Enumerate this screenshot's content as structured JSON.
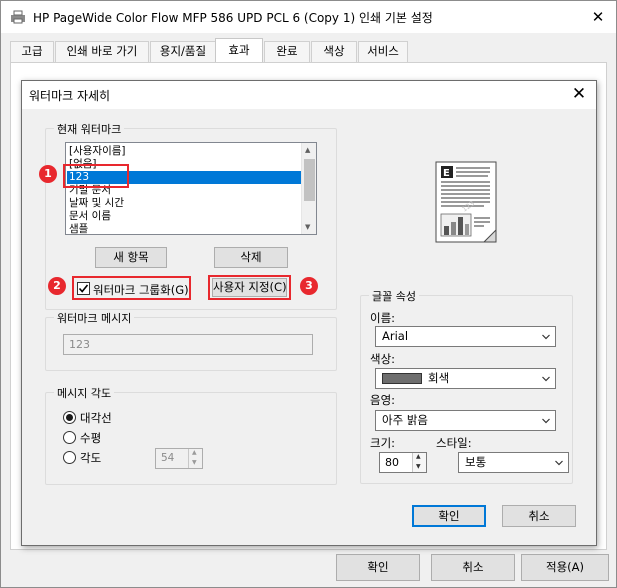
{
  "window": {
    "title": "HP PageWide Color Flow MFP 586 UPD PCL 6 (Copy 1) 인쇄 기본 설정",
    "close": "✕"
  },
  "tabs": [
    {
      "label": "고급"
    },
    {
      "label": "인쇄 바로 가기"
    },
    {
      "label": "용지/품질"
    },
    {
      "label": "효과",
      "active": true
    },
    {
      "label": "완료"
    },
    {
      "label": "색상"
    },
    {
      "label": "서비스"
    }
  ],
  "bottom_buttons": {
    "ok": "확인",
    "cancel": "취소",
    "apply": "적용(A)"
  },
  "dialog": {
    "title": "워터마크 자세히",
    "close": "✕",
    "current_watermark": {
      "label": "현재 워터마크",
      "items": [
        "[사용자이름]",
        "[없음]",
        "123",
        "기밀 문서",
        "날짜 및 시간",
        "문서 이름",
        "샘플"
      ],
      "selected_index": 2,
      "new_item": "새 항목",
      "delete": "삭제"
    },
    "callouts": [
      "1",
      "2",
      "3"
    ],
    "group_checkbox": {
      "label": "워터마크 그룹화(G)",
      "checked": true
    },
    "custom_button": "사용자 지정(C)",
    "message": {
      "label": "워터마크 메시지",
      "value": "123"
    },
    "angle": {
      "label": "메시지 각도",
      "options": [
        "대각선",
        "수평",
        "각도"
      ],
      "selected_index": 0,
      "angle_value": "54"
    },
    "font": {
      "label": "글꼴 속성",
      "name_label": "이름:",
      "name_value": "Arial",
      "color_label": "색상:",
      "color_value": "회색",
      "color_swatch": "#6e6e6e",
      "shade_label": "음영:",
      "shade_value": "아주 밝음",
      "size_label": "크기:",
      "size_value": "80",
      "style_label": "스타일:",
      "style_value": "보통"
    },
    "ok": "확인",
    "cancel": "취소"
  },
  "colors": {
    "accent": "#0078d7",
    "callout": "#e8282e",
    "default_button_border": "#0078d7"
  }
}
